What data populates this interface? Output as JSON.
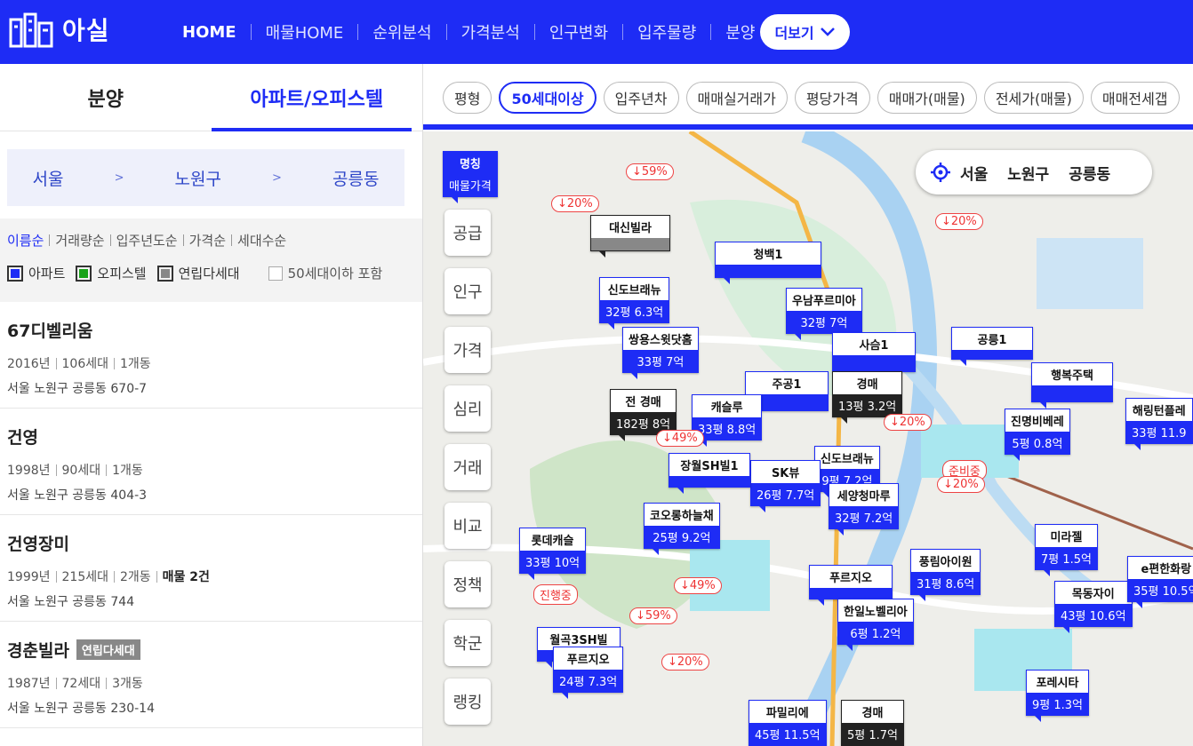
{
  "header": {
    "logo_text": "아실",
    "nav": [
      "HOME",
      "매물HOME",
      "순위분석",
      "가격분석",
      "인구변화",
      "입주물량",
      "분양"
    ],
    "more_label": "더보기"
  },
  "left": {
    "tabs": [
      "분양",
      "아파트/오피스텔"
    ],
    "breadcrumb": [
      "서울",
      "노원구",
      "공릉동"
    ],
    "breadcrumb_sep": ">",
    "sorts": [
      "이름순",
      "거래량순",
      "입주년도순",
      "가격순",
      "세대수순"
    ],
    "legend": [
      {
        "label": "아파트",
        "color": "#1e2cf5"
      },
      {
        "label": "오피스텔",
        "color": "#19a319"
      },
      {
        "label": "연립다세대",
        "color": "#888888"
      }
    ],
    "option_label": "50세대이하 포함",
    "items": [
      {
        "name": "67디벨리움",
        "badge": "",
        "year": "2016년",
        "units": "106세대",
        "bldg": "1개동",
        "listing": "",
        "addr": "서울 노원구 공릉동 670-7"
      },
      {
        "name": "건영",
        "badge": "",
        "year": "1998년",
        "units": "90세대",
        "bldg": "1개동",
        "listing": "",
        "addr": "서울 노원구 공릉동 404-3"
      },
      {
        "name": "건영장미",
        "badge": "",
        "year": "1999년",
        "units": "215세대",
        "bldg": "2개동",
        "listing": "매물 2건",
        "addr": "서울 노원구 공릉동 744"
      },
      {
        "name": "경춘빌라",
        "badge": "연립다세대",
        "year": "1987년",
        "units": "72세대",
        "bldg": "3개동",
        "listing": "",
        "addr": "서울 노원구 공릉동 230-14"
      }
    ]
  },
  "chips": [
    "평형",
    "50세대이상",
    "입주년차",
    "매매실거래가",
    "평당가격",
    "매매가(매물)",
    "전세가(매물)",
    "매매전세갭"
  ],
  "map": {
    "side_buttons": [
      "공급",
      "인구",
      "가격",
      "심리",
      "거래",
      "비교",
      "정책",
      "학군",
      "랭킹"
    ],
    "location": [
      "서울",
      "노원구",
      "공릉동"
    ],
    "pins": [
      {
        "t": "명칭",
        "v": "매물가격",
        "c": "b"
      },
      {
        "t": "청백1",
        "v": "",
        "c": "b"
      },
      {
        "t": "신도브래뉴",
        "v": "32평 6.3억",
        "c": "b"
      },
      {
        "t": "우남푸르미아",
        "v": "32평 7억",
        "c": "b"
      },
      {
        "t": "쌍용스윗닷홈",
        "v": "33평 7억",
        "c": "b"
      },
      {
        "t": "사슴1",
        "v": "",
        "c": "b"
      },
      {
        "t": "공릉1",
        "v": "",
        "c": "b"
      },
      {
        "t": "주공1",
        "v": "",
        "c": "b"
      },
      {
        "t": "행복주택",
        "v": "",
        "c": "b"
      },
      {
        "t": "경매",
        "v": "13평 3.2억",
        "c": "k"
      },
      {
        "t": "전 경매",
        "v": "182평 8억",
        "c": "k"
      },
      {
        "t": "캐슬루",
        "v": "33평 8.8억",
        "c": "b"
      },
      {
        "t": "진명비베레",
        "v": "5평 0.8억",
        "c": "b"
      },
      {
        "t": "해링턴플레",
        "v": "33평 11.9",
        "c": "b"
      },
      {
        "t": "신도브래뉴",
        "v": "9평 7.2억",
        "c": "b"
      },
      {
        "t": "SK뷰",
        "v": "26평 7.7억",
        "c": "b"
      },
      {
        "t": "세양청마루",
        "v": "32평 7.2억",
        "c": "b"
      },
      {
        "t": "장월SH빌1",
        "v": "",
        "c": "b"
      },
      {
        "t": "코오롱하늘채",
        "v": "25평 9.2억",
        "c": "b"
      },
      {
        "t": "롯데캐슬",
        "v": "33평 10억",
        "c": "b"
      },
      {
        "t": "풍림아이원",
        "v": "31평 8.6억",
        "c": "b"
      },
      {
        "t": "미라젤",
        "v": "7평 1.5억",
        "c": "b"
      },
      {
        "t": "푸르지오",
        "v": "",
        "c": "b"
      },
      {
        "t": "한일노벨리아",
        "v": "6평 1.2억",
        "c": "b"
      },
      {
        "t": "목동자이",
        "v": "43평 10.6억",
        "c": "b"
      },
      {
        "t": "e편한화랑",
        "v": "35평 10.5억",
        "c": "b"
      },
      {
        "t": "월곡3SH빌",
        "v": "",
        "c": "b"
      },
      {
        "t": "푸르지오",
        "v": "24평 7.3억",
        "c": "b"
      },
      {
        "t": "포레시타",
        "v": "9평 1.3억",
        "c": "b"
      },
      {
        "t": "파밀리에",
        "v": "45평 11.5억",
        "c": "b"
      },
      {
        "t": "경매",
        "v": "5평 1.7억",
        "c": "k"
      },
      {
        "t": "대신빌라",
        "v": "",
        "c": "k"
      }
    ],
    "drops": [
      "↓59%",
      "↓20%",
      "↓20%",
      "↓49%",
      "↓20%",
      "↓49%",
      "↓59%",
      "↓20%",
      "진행중",
      "준비중",
      "↓20%"
    ]
  }
}
